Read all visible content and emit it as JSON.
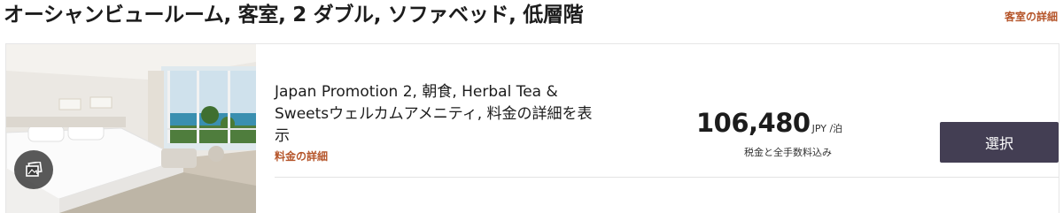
{
  "room": {
    "title": "オーシャンビュールーム, 客室, 2 ダブル, ソファベッド, 低層階",
    "details_link": "客室の詳細"
  },
  "photo": {
    "gallery_icon": "gallery-icon"
  },
  "rate": {
    "name": "Japan Promotion 2, 朝食, Herbal Tea & Sweetsウェルカムアメニティ, 料金の詳細を表示",
    "details_link": "料金の詳細",
    "price": "106,480",
    "currency_unit": "JPY /泊",
    "tax_note": "税金と全手数料込み",
    "select_label": "選択"
  },
  "colors": {
    "accent": "#b5552a",
    "button": "#433e53"
  }
}
